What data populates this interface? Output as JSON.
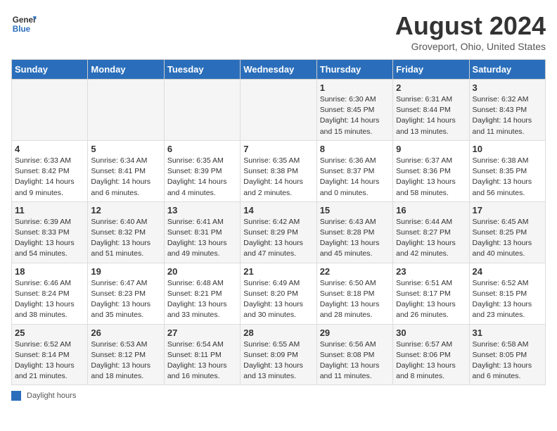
{
  "logo": {
    "line1": "General",
    "line2": "Blue"
  },
  "title": "August 2024",
  "subtitle": "Groveport, Ohio, United States",
  "days_of_week": [
    "Sunday",
    "Monday",
    "Tuesday",
    "Wednesday",
    "Thursday",
    "Friday",
    "Saturday"
  ],
  "weeks": [
    [
      {
        "day": "",
        "info": ""
      },
      {
        "day": "",
        "info": ""
      },
      {
        "day": "",
        "info": ""
      },
      {
        "day": "",
        "info": ""
      },
      {
        "day": "1",
        "info": "Sunrise: 6:30 AM\nSunset: 8:45 PM\nDaylight: 14 hours and 15 minutes."
      },
      {
        "day": "2",
        "info": "Sunrise: 6:31 AM\nSunset: 8:44 PM\nDaylight: 14 hours and 13 minutes."
      },
      {
        "day": "3",
        "info": "Sunrise: 6:32 AM\nSunset: 8:43 PM\nDaylight: 14 hours and 11 minutes."
      }
    ],
    [
      {
        "day": "4",
        "info": "Sunrise: 6:33 AM\nSunset: 8:42 PM\nDaylight: 14 hours and 9 minutes."
      },
      {
        "day": "5",
        "info": "Sunrise: 6:34 AM\nSunset: 8:41 PM\nDaylight: 14 hours and 6 minutes."
      },
      {
        "day": "6",
        "info": "Sunrise: 6:35 AM\nSunset: 8:39 PM\nDaylight: 14 hours and 4 minutes."
      },
      {
        "day": "7",
        "info": "Sunrise: 6:35 AM\nSunset: 8:38 PM\nDaylight: 14 hours and 2 minutes."
      },
      {
        "day": "8",
        "info": "Sunrise: 6:36 AM\nSunset: 8:37 PM\nDaylight: 14 hours and 0 minutes."
      },
      {
        "day": "9",
        "info": "Sunrise: 6:37 AM\nSunset: 8:36 PM\nDaylight: 13 hours and 58 minutes."
      },
      {
        "day": "10",
        "info": "Sunrise: 6:38 AM\nSunset: 8:35 PM\nDaylight: 13 hours and 56 minutes."
      }
    ],
    [
      {
        "day": "11",
        "info": "Sunrise: 6:39 AM\nSunset: 8:33 PM\nDaylight: 13 hours and 54 minutes."
      },
      {
        "day": "12",
        "info": "Sunrise: 6:40 AM\nSunset: 8:32 PM\nDaylight: 13 hours and 51 minutes."
      },
      {
        "day": "13",
        "info": "Sunrise: 6:41 AM\nSunset: 8:31 PM\nDaylight: 13 hours and 49 minutes."
      },
      {
        "day": "14",
        "info": "Sunrise: 6:42 AM\nSunset: 8:29 PM\nDaylight: 13 hours and 47 minutes."
      },
      {
        "day": "15",
        "info": "Sunrise: 6:43 AM\nSunset: 8:28 PM\nDaylight: 13 hours and 45 minutes."
      },
      {
        "day": "16",
        "info": "Sunrise: 6:44 AM\nSunset: 8:27 PM\nDaylight: 13 hours and 42 minutes."
      },
      {
        "day": "17",
        "info": "Sunrise: 6:45 AM\nSunset: 8:25 PM\nDaylight: 13 hours and 40 minutes."
      }
    ],
    [
      {
        "day": "18",
        "info": "Sunrise: 6:46 AM\nSunset: 8:24 PM\nDaylight: 13 hours and 38 minutes."
      },
      {
        "day": "19",
        "info": "Sunrise: 6:47 AM\nSunset: 8:23 PM\nDaylight: 13 hours and 35 minutes."
      },
      {
        "day": "20",
        "info": "Sunrise: 6:48 AM\nSunset: 8:21 PM\nDaylight: 13 hours and 33 minutes."
      },
      {
        "day": "21",
        "info": "Sunrise: 6:49 AM\nSunset: 8:20 PM\nDaylight: 13 hours and 30 minutes."
      },
      {
        "day": "22",
        "info": "Sunrise: 6:50 AM\nSunset: 8:18 PM\nDaylight: 13 hours and 28 minutes."
      },
      {
        "day": "23",
        "info": "Sunrise: 6:51 AM\nSunset: 8:17 PM\nDaylight: 13 hours and 26 minutes."
      },
      {
        "day": "24",
        "info": "Sunrise: 6:52 AM\nSunset: 8:15 PM\nDaylight: 13 hours and 23 minutes."
      }
    ],
    [
      {
        "day": "25",
        "info": "Sunrise: 6:52 AM\nSunset: 8:14 PM\nDaylight: 13 hours and 21 minutes."
      },
      {
        "day": "26",
        "info": "Sunrise: 6:53 AM\nSunset: 8:12 PM\nDaylight: 13 hours and 18 minutes."
      },
      {
        "day": "27",
        "info": "Sunrise: 6:54 AM\nSunset: 8:11 PM\nDaylight: 13 hours and 16 minutes."
      },
      {
        "day": "28",
        "info": "Sunrise: 6:55 AM\nSunset: 8:09 PM\nDaylight: 13 hours and 13 minutes."
      },
      {
        "day": "29",
        "info": "Sunrise: 6:56 AM\nSunset: 8:08 PM\nDaylight: 13 hours and 11 minutes."
      },
      {
        "day": "30",
        "info": "Sunrise: 6:57 AM\nSunset: 8:06 PM\nDaylight: 13 hours and 8 minutes."
      },
      {
        "day": "31",
        "info": "Sunrise: 6:58 AM\nSunset: 8:05 PM\nDaylight: 13 hours and 6 minutes."
      }
    ]
  ],
  "footer": {
    "legend_label": "Daylight hours"
  }
}
